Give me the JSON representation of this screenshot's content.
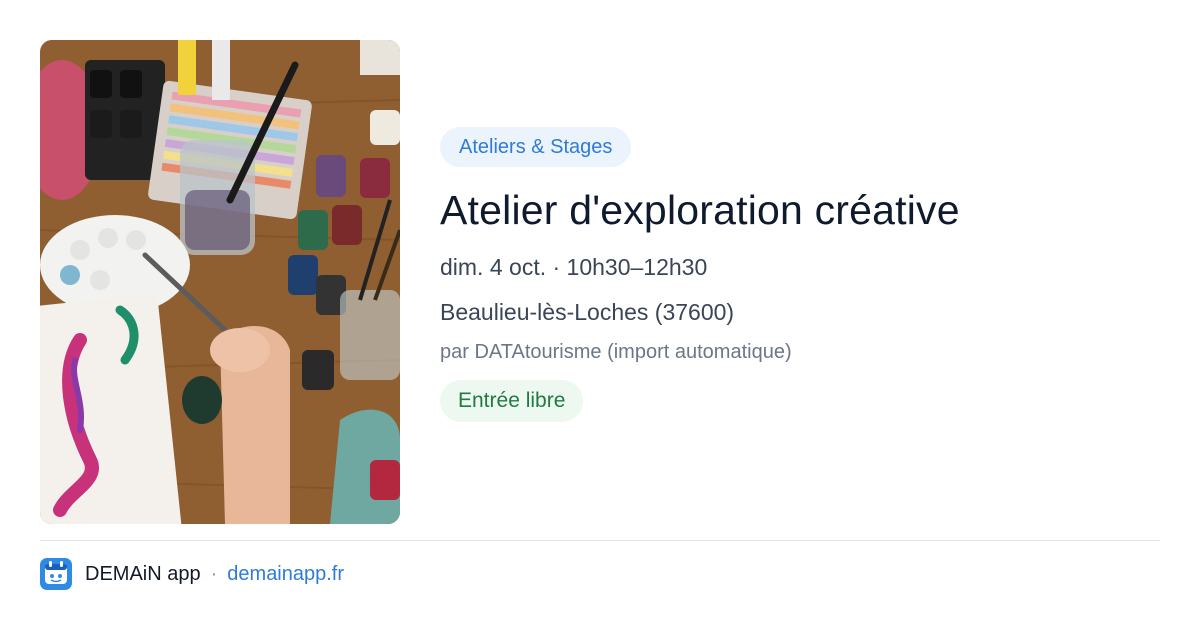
{
  "event": {
    "image_alt": "Atelier d'exploration créative",
    "category": "Ateliers & Stages",
    "title": "Atelier d'exploration créative",
    "date_time": "dim. 4 oct. · 10h30–12h30",
    "location": "Beaulieu-lès-Loches (37600)",
    "source": "par DATAtourisme (import automatique)",
    "price": "Entrée libre"
  },
  "footer": {
    "app_name": "DEMAiN app",
    "separator": "·",
    "url": "demainapp.fr",
    "logo_icon": "demain-app-logo-icon"
  },
  "colors": {
    "category_chip_bg": "#ebf3fd",
    "category_chip_text": "#2f7bd9",
    "title": "#0f1b2d",
    "price_chip_bg": "#edf8f0",
    "price_chip_text": "#217a43",
    "link": "#2f7bd9"
  }
}
